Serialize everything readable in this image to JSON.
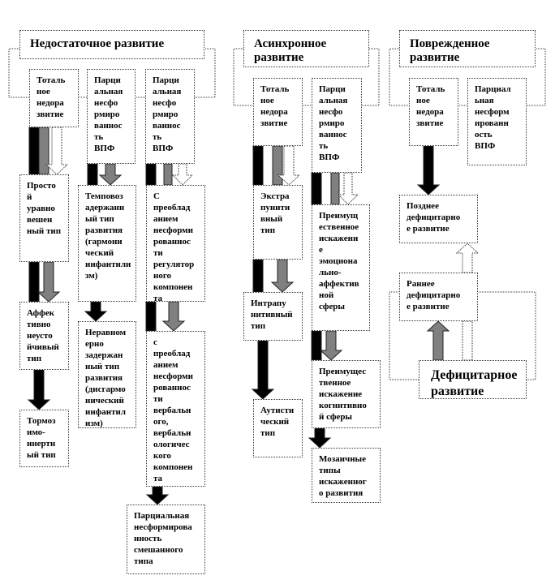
{
  "groups": {
    "insufficient": {
      "title": "Недостаточное развитие",
      "total": "Тоталь\nное\nнедора\nзвитие",
      "partial_a": "Парци\nальная\nнесфо\nрмиро\nваннос\nть\nВПФ",
      "partial_b": "Парци\nальная\nнесфо\nрмиро\nваннос\nть\nВПФ",
      "simple": "Просто\nй\nуравно\nвешен\nный тип",
      "affective": "Аффек\nтивно\nнеусто\nйчивый\nтип",
      "inhibited": "Тормоз\nимо-\nинертн\nый тип",
      "tempo": "Темповоз\nадержанн\nый тип\nразвития\n(гармони\nческий\nинфантили\nзм)",
      "uneven": "Неравном\nерно\nзадержан\nный тип\nразвития\n(дисгармо\nнический\nинфантил\nизм)",
      "regulatory": "С\nпреоблад\nанием\nнесформи\nрованнос\nти\nрегулятор\nного\nкомпонен\nта",
      "verbal": "с\nпреоблад\nанием\nнесформи\nрованнос\nти\nвербальн\nого,\nвербальн\nологичес\nкого\nкомпонен\nта",
      "mixed": "Парциальная\nнесформирова\nнность\nсмешанного\nтипа"
    },
    "asynchronous": {
      "title": "Асинхронное\nразвитие",
      "total": "Тоталь\nное\nнедора\nзвитие",
      "partial": "Парци\nальная\nнесфо\nрмиро\nваннос\nть\nВПФ",
      "extrapunitive": "Экстра\nпунити\nвный\nтип",
      "intrapunitive": "Интрапу\nнитивный\nтип",
      "autistic": "Аутисти\nческий\nтип",
      "emotional": "Преимущ\nественное\nискажени\nе\nэмоциона\nльно-\nаффектив\nной\nсферы",
      "cognitive": "Преимущес\nтвенное\nискажение\nкогнитивно\nй сферы",
      "mosaic": "Мозаичные\nтипы\nискаженног\nо развития"
    },
    "damaged": {
      "title": "Поврежденное\nразвитие",
      "total": "Тоталь\nное\nнедора\nзвитие",
      "partial": "Парциал\nьная\nнесформ\nированн\nость\nВПФ",
      "late": "Позднее\nдефицитарно\nе развитие",
      "early": "Раннее\nдефицитарно\nе развитие",
      "deficit": "Дефицитарное\nразвитие"
    }
  },
  "colors": {
    "black_arrow": "#000000",
    "gray_arrow": "#808080",
    "white_arrow": "#ffffff",
    "border": "#333333"
  }
}
